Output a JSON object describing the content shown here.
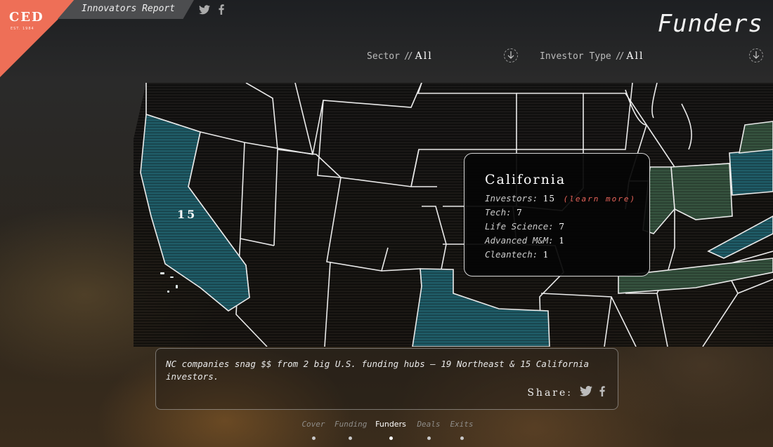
{
  "brand": {
    "logo": "CED",
    "logo_sub": "EST. 1984",
    "report_title": "Innovators Report"
  },
  "page": {
    "title": "Funders"
  },
  "filters": {
    "sector": {
      "label": "Sector",
      "value": "All"
    },
    "investor_type": {
      "label": "Investor Type",
      "value": "All"
    }
  },
  "map": {
    "highlight_count": "15",
    "highlight_state": "California"
  },
  "tooltip": {
    "state": "California",
    "rows": [
      {
        "key": "Investors:",
        "value": "15",
        "link": "(learn more)"
      },
      {
        "key": "Tech:",
        "value": "7"
      },
      {
        "key": "Life Science:",
        "value": "7"
      },
      {
        "key": "Advanced M&M:",
        "value": "1"
      },
      {
        "key": "Cleantech:",
        "value": "1"
      }
    ]
  },
  "caption": {
    "text": "NC companies snag $$ from 2 big U.S. funding hubs — 19 Northeast & 15 California investors.",
    "share_label": "Share:"
  },
  "nav": {
    "items": [
      {
        "label": "Cover"
      },
      {
        "label": "Funding"
      },
      {
        "label": "Funders"
      },
      {
        "label": "Deals"
      },
      {
        "label": "Exits"
      }
    ],
    "active": "Funders"
  },
  "colors": {
    "accent": "#ee6f57",
    "teal": "#1e5a66",
    "green": "#34503e",
    "link": "#e8645a"
  },
  "icons": [
    "twitter-icon",
    "facebook-icon",
    "chevron-down-icon"
  ]
}
